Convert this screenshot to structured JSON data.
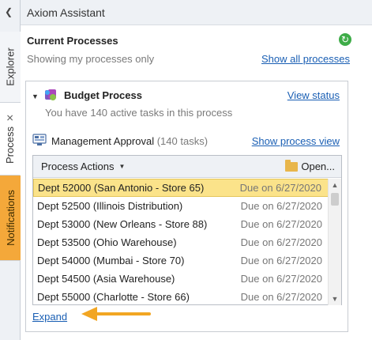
{
  "window": {
    "title": "Axiom Assistant"
  },
  "side_tabs": [
    {
      "label": "Explorer"
    },
    {
      "label": "Process",
      "close": "✕"
    },
    {
      "label": "Notifications"
    }
  ],
  "current_processes": {
    "heading": "Current Processes",
    "filter_text": "Showing my processes only",
    "show_all_link": "Show all processes"
  },
  "budget_process": {
    "title": "Budget Process",
    "subtitle": "You have 140 active tasks in this process",
    "view_status_link": "View status",
    "step": {
      "title": "Management Approval",
      "count": "(140 tasks)",
      "show_process_view_link": "Show process view"
    },
    "toolbar": {
      "actions_label": "Process Actions",
      "open_label": "Open..."
    },
    "rows": [
      {
        "name": "Dept 52000 (San Antonio - Store 65)",
        "due": "Due on 6/27/2020",
        "selected": true
      },
      {
        "name": "Dept 52500 (Illinois Distribution)",
        "due": "Due on 6/27/2020"
      },
      {
        "name": "Dept 53000 (New Orleans - Store 88)",
        "due": "Due on 6/27/2020"
      },
      {
        "name": "Dept 53500 (Ohio Warehouse)",
        "due": "Due on 6/27/2020"
      },
      {
        "name": "Dept 54000 (Mumbai - Store 70)",
        "due": "Due on 6/27/2020"
      },
      {
        "name": "Dept 54500 (Asia Warehouse)",
        "due": "Due on 6/27/2020"
      },
      {
        "name": "Dept 55000 (Charlotte - Store 66)",
        "due": "Due on 6/27/2020"
      }
    ],
    "expand_link": "Expand"
  },
  "colors": {
    "link": "#1a5fb4",
    "selected_row": "#fbe38a",
    "notifications_tab": "#f4a83a",
    "callout_arrow": "#f2a623",
    "refresh_icon": "#3eac48"
  }
}
